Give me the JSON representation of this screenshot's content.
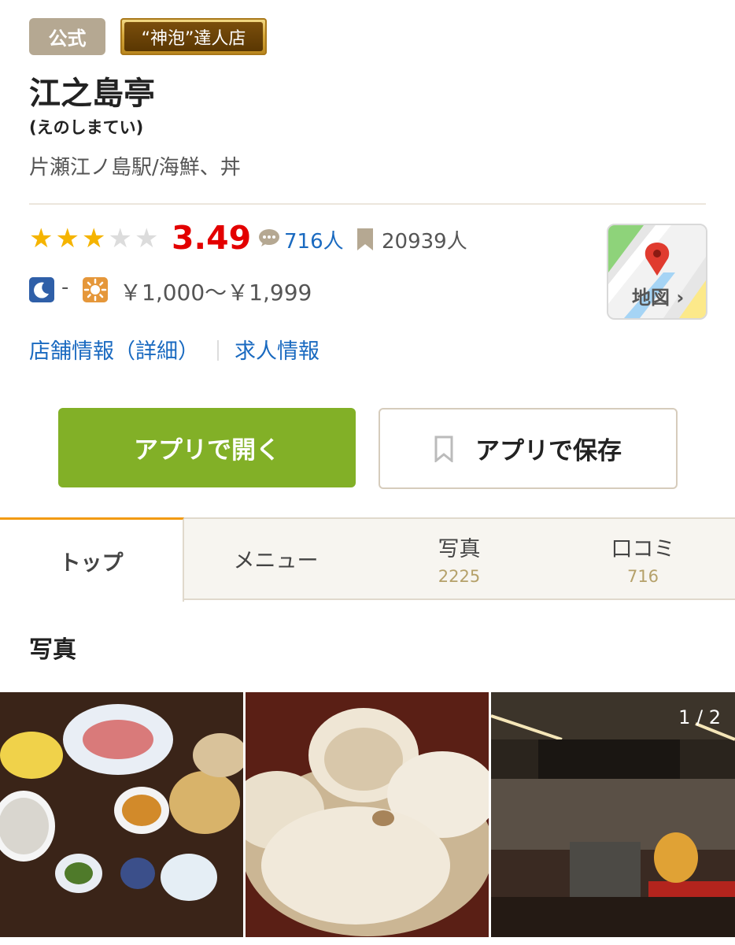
{
  "badges": {
    "official": "公式",
    "master": "“神泡”達人店"
  },
  "shop": {
    "name": "江之島亭",
    "kana": "(えのしまてい)",
    "area": "片瀬江ノ島駅/海鮮、丼"
  },
  "rating": {
    "stars_filled": 3,
    "stars_total": 5,
    "score": "3.49",
    "review_count": "716人",
    "bookmark_count": "20939人"
  },
  "budget": {
    "dinner": "-",
    "lunch": "￥1,000〜￥1,999"
  },
  "map": {
    "label": "地図 ›"
  },
  "links": {
    "details": "店舗情報（詳細）",
    "jobs": "求人情報"
  },
  "buttons": {
    "open": "アプリで開く",
    "save": "アプリで保存"
  },
  "tabs": {
    "top": "トップ",
    "menu": "メニュー",
    "photos": {
      "label": "写真",
      "count": "2225"
    },
    "reviews": {
      "label": "口コミ",
      "count": "716"
    }
  },
  "photos_section": {
    "title": "写真",
    "pager": "1 / 2"
  },
  "colors": {
    "accent_green": "#82b027",
    "rating_red": "#e30000",
    "link_blue": "#1a6ac0",
    "tab_orange": "#ef8c00"
  }
}
